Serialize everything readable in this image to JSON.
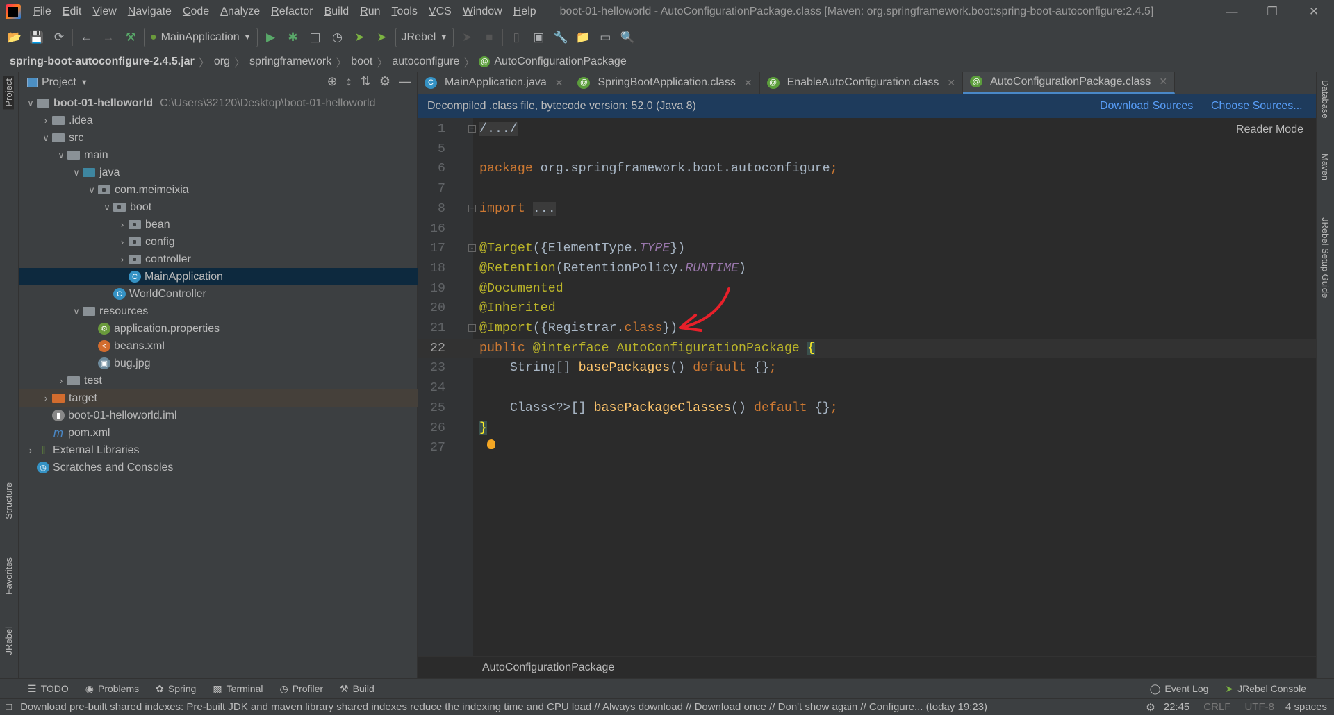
{
  "menu": [
    "File",
    "Edit",
    "View",
    "Navigate",
    "Code",
    "Analyze",
    "Refactor",
    "Build",
    "Run",
    "Tools",
    "VCS",
    "Window",
    "Help"
  ],
  "title": "boot-01-helloworld - AutoConfigurationPackage.class [Maven: org.springframework.boot:spring-boot-autoconfigure:2.4.5]",
  "toolbar": {
    "run_config": "MainApplication",
    "jrebel": "JRebel"
  },
  "breadcrumb": {
    "jar": "spring-boot-autoconfigure-2.4.5.jar",
    "parts": [
      "org",
      "springframework",
      "boot",
      "autoconfigure"
    ],
    "current": "AutoConfigurationPackage"
  },
  "project": {
    "title": "Project",
    "root": "boot-01-helloworld",
    "root_path": "C:\\Users\\32120\\Desktop\\boot-01-helloworld",
    "rows": [
      ".idea",
      "src",
      "main",
      "java",
      "com.meimeixia",
      "boot",
      "bean",
      "config",
      "controller",
      "MainApplication",
      "WorldController",
      "resources",
      "application.properties",
      "beans.xml",
      "bug.jpg",
      "test",
      "target",
      "boot-01-helloworld.iml",
      "pom.xml",
      "External Libraries",
      "Scratches and Consoles"
    ]
  },
  "tabs": [
    "MainApplication.java",
    "SpringBootApplication.class",
    "EnableAutoConfiguration.class",
    "AutoConfigurationPackage.class"
  ],
  "active_tab": "AutoConfigurationPackage.class",
  "notice": {
    "text": "Decompiled .class file, bytecode version: 52.0 (Java 8)",
    "download": "Download Sources",
    "choose": "Choose Sources..."
  },
  "reader_mode": "Reader Mode",
  "code": [
    {
      "n": "1",
      "t": [
        [
          "fold-t",
          "/.../"
        ]
      ]
    },
    {
      "n": "5",
      "t": []
    },
    {
      "n": "6",
      "t": [
        [
          "kw",
          "package "
        ],
        [
          "pl",
          "org.springframework.boot.autoconfigure"
        ],
        [
          "kw",
          ";"
        ]
      ]
    },
    {
      "n": "7",
      "t": []
    },
    {
      "n": "8",
      "t": [
        [
          "kw",
          "import "
        ],
        [
          "fold-t",
          "..."
        ]
      ]
    },
    {
      "n": "16",
      "t": []
    },
    {
      "n": "17",
      "t": [
        [
          "ann",
          "@Target"
        ],
        [
          "pl",
          "({ElementType."
        ],
        [
          "fld",
          "TYPE"
        ],
        [
          "pl",
          "})"
        ]
      ]
    },
    {
      "n": "18",
      "t": [
        [
          "ann",
          "@Retention"
        ],
        [
          "pl",
          "(RetentionPolicy."
        ],
        [
          "fld",
          "RUNTIME"
        ],
        [
          "pl",
          ")"
        ]
      ]
    },
    {
      "n": "19",
      "t": [
        [
          "ann",
          "@Documented"
        ]
      ]
    },
    {
      "n": "20",
      "t": [
        [
          "ann",
          "@Inherited"
        ]
      ]
    },
    {
      "n": "21",
      "t": [
        [
          "ann",
          "@Import"
        ],
        [
          "pl",
          "({Registrar."
        ],
        [
          "kw",
          "class"
        ],
        [
          "pl",
          "})"
        ]
      ]
    },
    {
      "n": "22",
      "t": [
        [
          "kw",
          "public "
        ],
        [
          "ann",
          "@interface "
        ],
        [
          "ann",
          "AutoConfigurationPackage "
        ],
        [
          "brace",
          "{"
        ]
      ]
    },
    {
      "n": "23",
      "t": [
        [
          "pl",
          "    String[] "
        ],
        [
          "mth",
          "basePackages"
        ],
        [
          "pl",
          "() "
        ],
        [
          "kw",
          "default "
        ],
        [
          "pl",
          "{}"
        ],
        [
          "kw",
          ";"
        ]
      ]
    },
    {
      "n": "24",
      "t": []
    },
    {
      "n": "25",
      "t": [
        [
          "pl",
          "    Class<?>[] "
        ],
        [
          "mth",
          "basePackageClasses"
        ],
        [
          "pl",
          "() "
        ],
        [
          "kw",
          "default "
        ],
        [
          "pl",
          "{}"
        ],
        [
          "kw",
          ";"
        ]
      ]
    },
    {
      "n": "26",
      "t": [
        [
          "brace",
          "}"
        ]
      ]
    },
    {
      "n": "27",
      "t": []
    }
  ],
  "editor_footer": "AutoConfigurationPackage",
  "left_stripe": [
    "Project",
    "Structure",
    "Favorites",
    "JRebel"
  ],
  "right_stripe": [
    "Database",
    "Maven",
    "JRebel Setup Guide"
  ],
  "bottom_tools": [
    "TODO",
    "Problems",
    "Spring",
    "Terminal",
    "Profiler",
    "Build"
  ],
  "bottom_right": [
    "Event Log",
    "JRebel Console"
  ],
  "status": {
    "message": "Download pre-built shared indexes: Pre-built JDK and maven library shared indexes reduce the indexing time and CPU load // Always download // Download once // Don't show again // Configure... (today 19:23)",
    "position": "22:45",
    "line_sep": "CRLF",
    "encoding": "UTF-8",
    "indent": "4 spaces"
  },
  "colors": {
    "keyword": "#cc7832",
    "annotation": "#bbb529",
    "constant": "#9876aa",
    "method": "#ffc66d",
    "text": "#a9b7c6",
    "link": "#589df6",
    "annotation_arrow": "#e8202a"
  }
}
